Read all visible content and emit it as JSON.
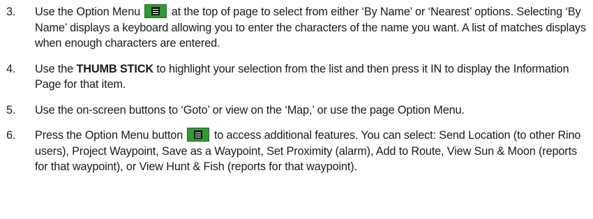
{
  "steps": [
    {
      "number": "3.",
      "before_icon": "Use the Option Menu",
      "icon": "option-menu-icon",
      "after_icon": "at the top of page to select from either ‘By Name’ or ‘Nearest’ options. Selecting ‘By Name’ displays a keyboard allowing you to enter the characters of the name you want. A list of matches displays when enough characters are entered."
    },
    {
      "number": "4.",
      "before_bold": "Use the",
      "bold": "THUMB STICK",
      "after_bold": "to highlight your selection from the list and then press it IN to display the Information Page for that item."
    },
    {
      "number": "5.",
      "text": "Use the on-screen buttons to ‘Goto’ or view on the ‘Map,’ or use the page Option Menu."
    },
    {
      "number": "6.",
      "before_icon": "Press the Option Menu button",
      "icon": "option-menu-icon",
      "after_icon": "to access additional features. You can select: Send Location (to other Rino users), Project Waypoint, Save as a Waypoint, Set Proximity (alarm), Add to Route, View Sun & Moon (reports for that waypoint), or View Hunt & Fish (reports for that waypoint)."
    }
  ],
  "colors": {
    "menu_button_fill": "#2f9a2f",
    "menu_button_border": "#1d6a1d",
    "text": "#1a1a1a"
  }
}
